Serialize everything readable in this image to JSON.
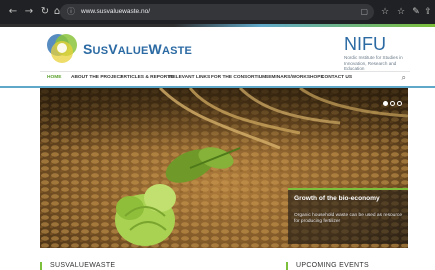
{
  "browser": {
    "url": "www.susvaluewaste.no/",
    "nav_icons": [
      "back-icon",
      "forward-icon",
      "reload-icon",
      "home-icon"
    ],
    "right_icons": [
      "star-icon",
      "favorites-icon",
      "pen-icon",
      "share-icon"
    ]
  },
  "header": {
    "logo_text_big1": "S",
    "logo_text_small1": "US",
    "logo_text_big2": "V",
    "logo_text_small2": "ALUE",
    "logo_text_big3": "W",
    "logo_text_small3": "ASTE",
    "partner_title": "NIFU",
    "partner_subtitle": "Nordic Institute for Studies in Innovation, Research and Education"
  },
  "nav": {
    "items": [
      {
        "label": "HOME",
        "active": true
      },
      {
        "label": "ABOUT THE PROJECT",
        "active": false
      },
      {
        "label": "ARTICLES & REPORTS",
        "active": false
      },
      {
        "label": "RELEVANT LINKS",
        "active": false
      },
      {
        "label": "FOR THE CONSORTIUM",
        "active": false
      },
      {
        "label": "SEMINARS/WORKSHOPS",
        "active": false
      },
      {
        "label": "CONTACT US",
        "active": false
      }
    ]
  },
  "hero": {
    "caption_title": "Growth of the bio-economy",
    "caption_text": "Organic household waste can be used as resource for producing fertilizer",
    "slide_count": 3,
    "active_slide": 0
  },
  "sections": {
    "left_heading": "SUSVALUEWASTE",
    "right_heading": "UPCOMING EVENTS"
  },
  "colors": {
    "brand_blue": "#2b6aa3",
    "accent_green": "#7cbf3a",
    "nav_active": "#5aa02c"
  }
}
